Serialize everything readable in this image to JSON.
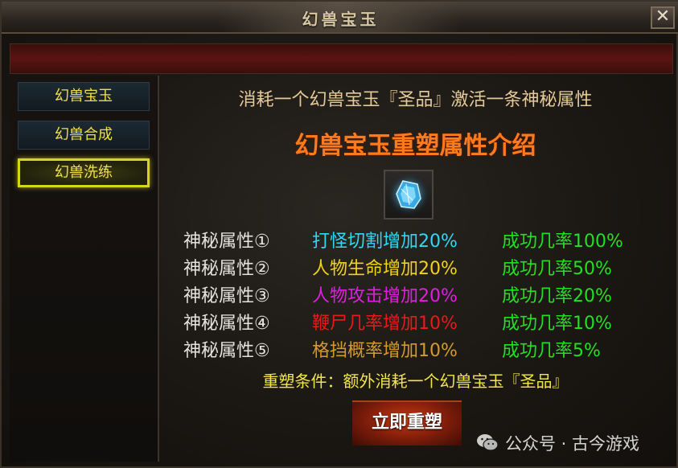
{
  "window": {
    "title": "幻兽宝玉",
    "close_label": "✕"
  },
  "sidebar": {
    "items": [
      {
        "label": "幻兽宝玉",
        "active": false
      },
      {
        "label": "幻兽合成",
        "active": false
      },
      {
        "label": "幻兽洗练",
        "active": true
      }
    ]
  },
  "content": {
    "headline": "消耗一个幻兽宝玉『圣品』激活一条神秘属性",
    "title": "幻兽宝玉重塑属性介绍",
    "gem_icon": "blue-gem-icon",
    "attributes": [
      {
        "name": "神秘属性①",
        "effect": "打怪切割增加20%",
        "effect_color": "#2fd8f5",
        "rate": "成功几率100%"
      },
      {
        "name": "神秘属性②",
        "effect": "人物生命增加20%",
        "effect_color": "#f2d21a",
        "rate": "成功几率50%"
      },
      {
        "name": "神秘属性③",
        "effect": "人物攻击增加20%",
        "effect_color": "#e01ee0",
        "rate": "成功几率20%"
      },
      {
        "name": "神秘属性④",
        "effect": "鞭尸几率增加10%",
        "effect_color": "#e81a1a",
        "rate": "成功几率10%"
      },
      {
        "name": "神秘属性⑤",
        "effect": "格挡概率增加10%",
        "effect_color": "#d49a2a",
        "rate": "成功几率5%"
      }
    ],
    "condition": "重塑条件：额外消耗一个幻兽宝玉『圣品』",
    "button_label": "立即重塑"
  },
  "watermark": {
    "text": "公众号 · 古今游戏",
    "icon": "wechat-icon"
  },
  "colors": {
    "rate_green": "#22e022",
    "title_orange": "#ff7a1a",
    "tab_yellow": "#f0e04a"
  }
}
